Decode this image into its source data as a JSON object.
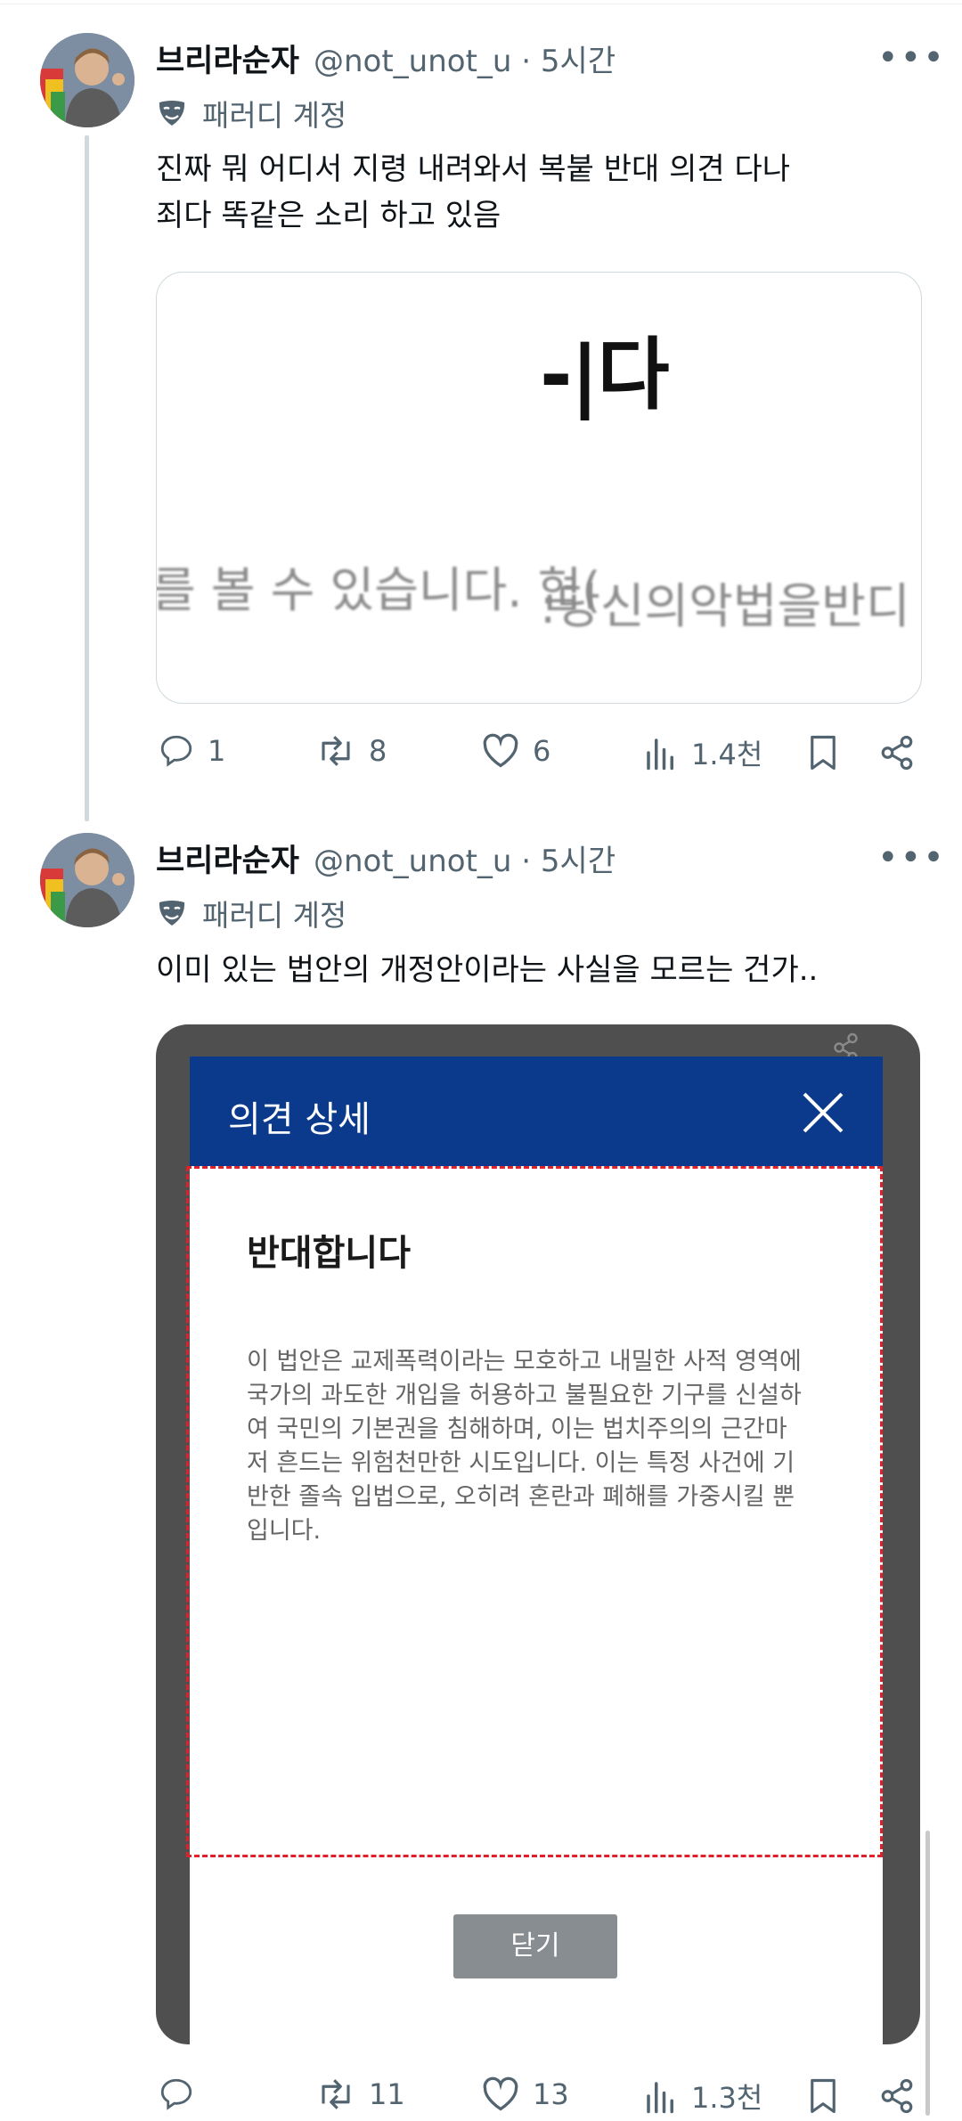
{
  "tweets": [
    {
      "author": {
        "name": "브리라순자",
        "handle": "@not_unot_u",
        "time": "5시간",
        "label": "패러디 계정"
      },
      "text_lines": [
        "진짜 뭐 어디서 지령 내려와서 복붙 반대 의견 다나",
        "죄다 똑같은 소리 하고 있음"
      ],
      "media": {
        "top_text": "-|다",
        "left_text": "를 볼 수 있습니다. 협(",
        "right_text": ":당신의악법을반디"
      },
      "actions": {
        "replies": "1",
        "reposts": "8",
        "likes": "6",
        "views": "1.4천"
      },
      "more_label": "•••"
    },
    {
      "author": {
        "name": "브리라순자",
        "handle": "@not_unot_u",
        "time": "5시간",
        "label": "패러디 계정"
      },
      "text_lines": [
        "이미 있는 법안의 개정안이라는 사실을 모르는 건가.."
      ],
      "media": {
        "modal_title": "의견 상세",
        "opinion_title": "반대합니다",
        "opinion_body_lines": [
          "이 법안은 교제폭력이라는 모호하고 내밀한 사적 영역에",
          "국가의 과도한 개입을 허용하고 불필요한 기구를 신설하",
          "여 국민의 기본권을 침해하며, 이는 법치주의의 근간마",
          "저 흔드는 위험천만한 시도입니다. 이는 특정 사건에 기",
          "반한 졸속 입법으로, 오히려 혼란과 폐해를 가중시킬 뿐",
          "입니다."
        ],
        "close_button": "닫기"
      },
      "actions": {
        "replies": "",
        "reposts": "11",
        "likes": "13",
        "views": "1.3천"
      },
      "more_label": "•••"
    }
  ],
  "colors": {
    "text": "#0f1419",
    "secondary": "#536471",
    "modal_header": "#0b3a8c",
    "dashed_border": "#e0212b",
    "close_button": "#888d92"
  }
}
